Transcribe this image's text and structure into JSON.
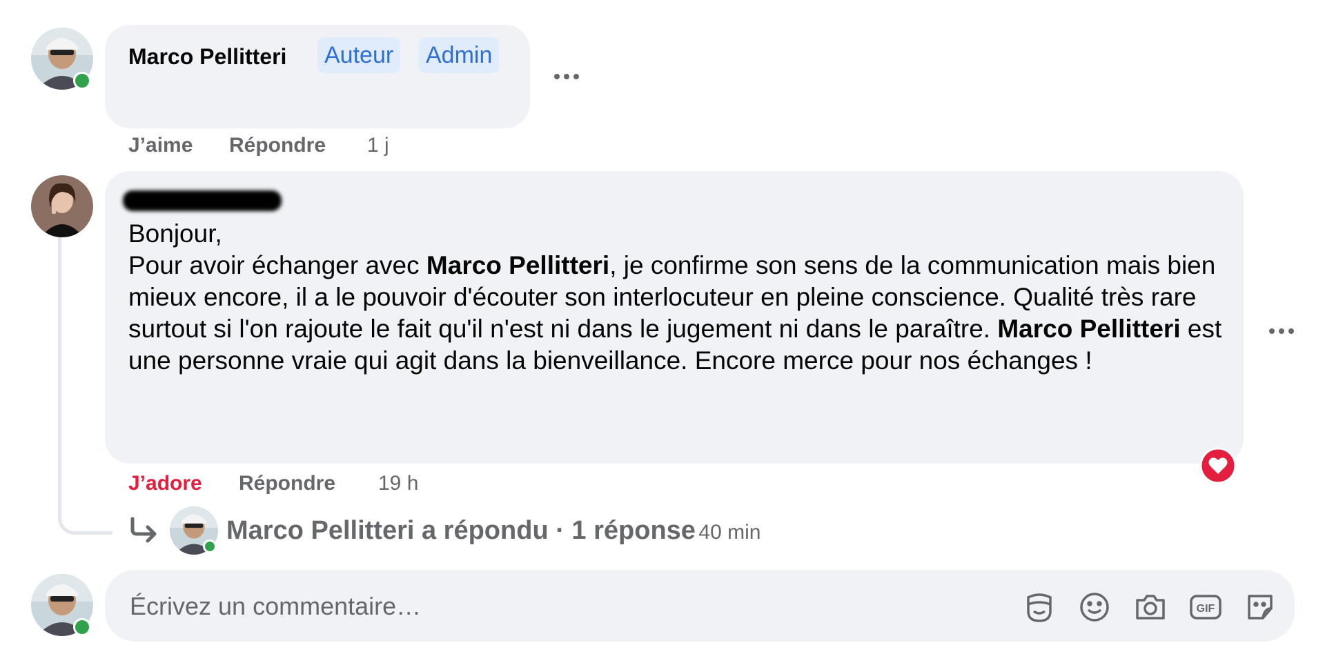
{
  "first_comment": {
    "author": "Marco Pellitteri",
    "badges": [
      "Auteur",
      "Admin"
    ],
    "actions": {
      "like": "J’aime",
      "reply": "Répondre"
    },
    "time": "1 j"
  },
  "second_comment": {
    "body": {
      "greeting": "Bonjour,",
      "p1": "Pour avoir échanger avec ",
      "mention1": "Marco Pellitteri",
      "p2": ", je confirme son sens de la communication mais bien mieux encore, il a le pouvoir d'écouter son interlocuteur en pleine conscience. Qualité très rare surtout si l'on rajoute le fait qu'il n'est ni dans le jugement ni dans le paraître. ",
      "mention2": "Marco Pellitteri",
      "p3": " est une personne vraie qui agit dans la bienveillance. Encore merce pour nos échanges !"
    },
    "actions": {
      "love": "J’adore",
      "reply": "Répondre"
    },
    "time": "19 h",
    "reaction_icon": "heart-icon"
  },
  "reply_summary": {
    "text": "Marco Pellitteri a répondu · 1 réponse",
    "time": "40 min"
  },
  "composer": {
    "placeholder": "Écrivez un commentaire…",
    "tools": [
      "avatar-sticker-icon",
      "emoji-icon",
      "camera-icon",
      "gif-icon",
      "sticker-icon"
    ]
  },
  "colors": {
    "bubble": "#f0f2f5",
    "badge_bg": "#e0ebfb",
    "badge_text": "#2e6fd6",
    "love": "#e41e3f",
    "online": "#31a24c",
    "muted": "#65676b"
  }
}
